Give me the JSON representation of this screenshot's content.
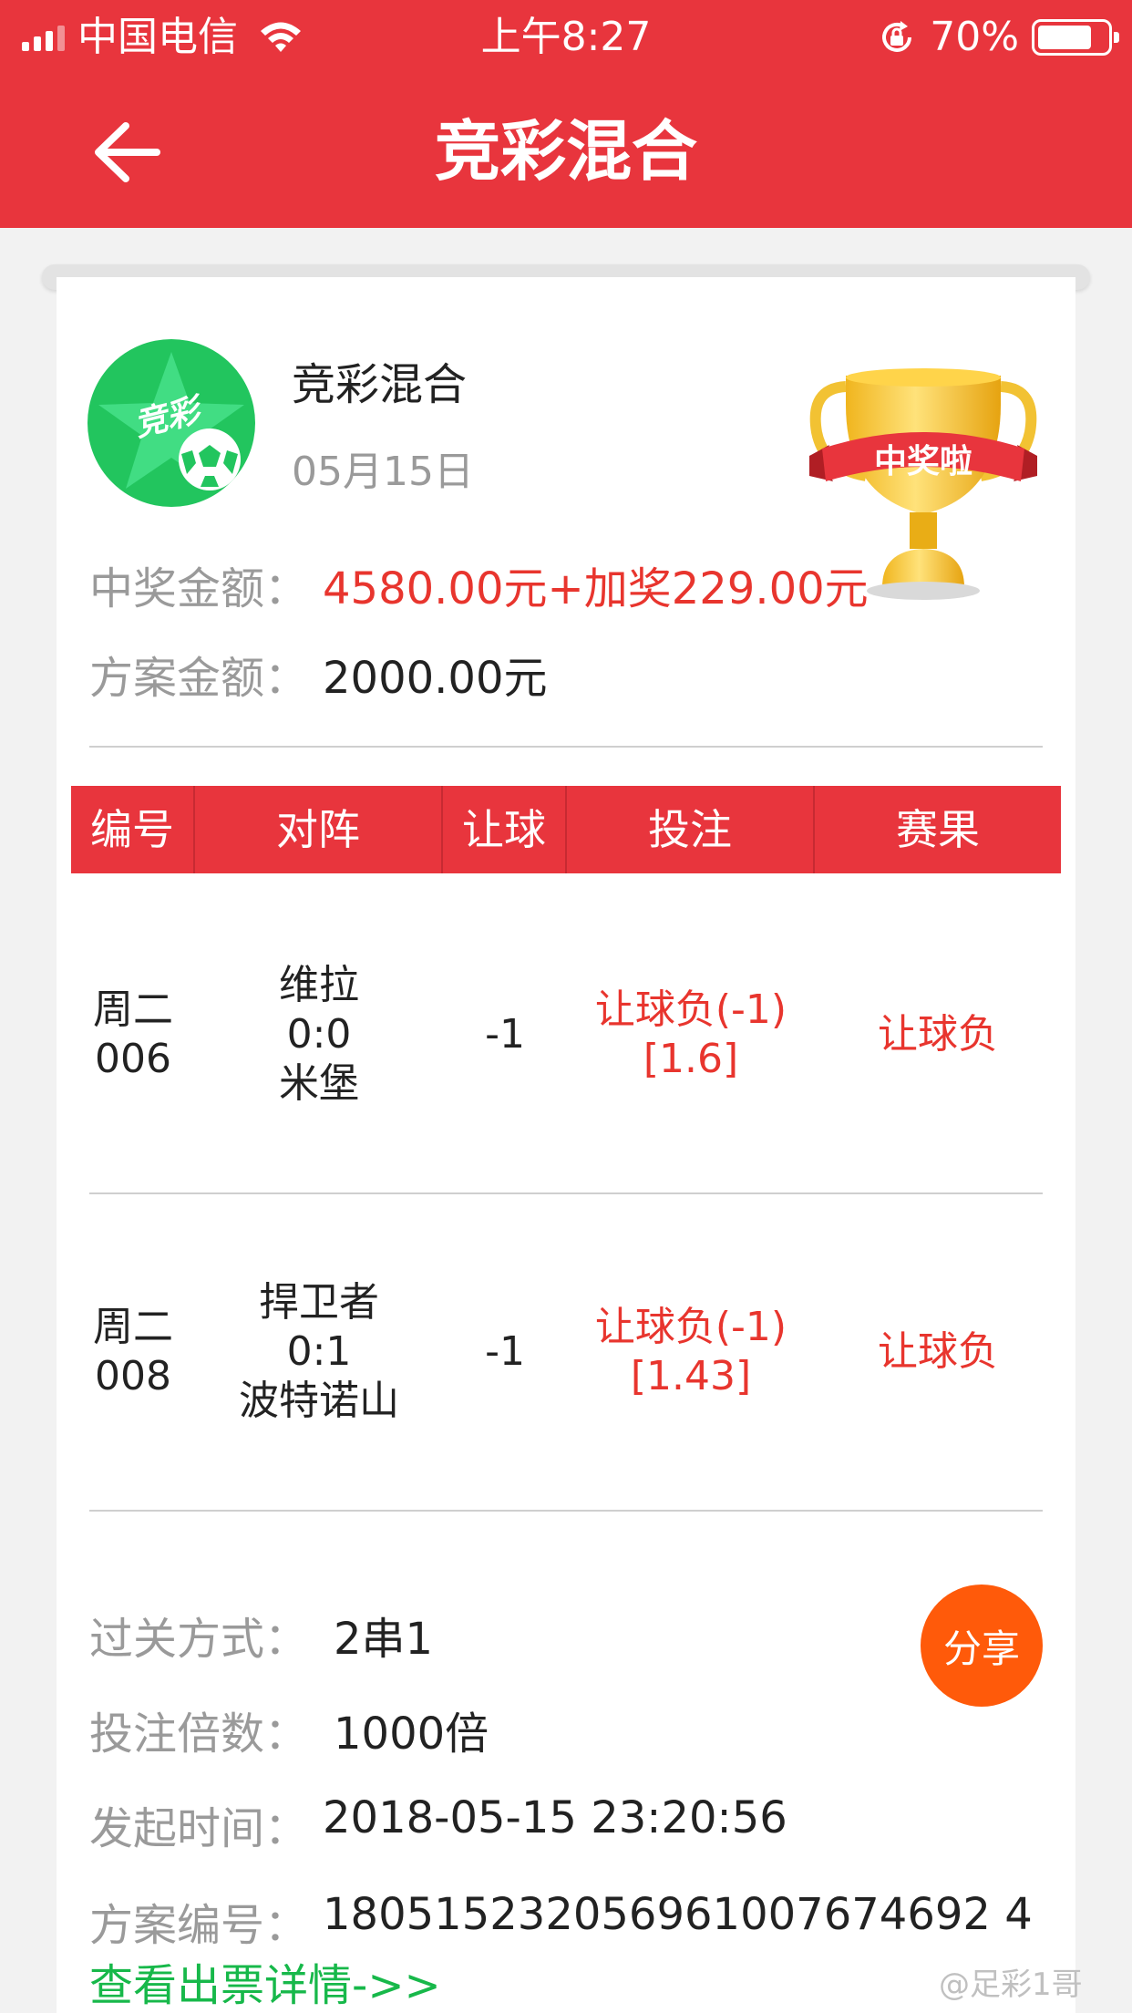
{
  "status_bar": {
    "carrier": "中国电信",
    "time": "上午8:27",
    "battery": "70%"
  },
  "nav": {
    "title": "竞彩混合"
  },
  "summary": {
    "lottery_name": "竞彩混合",
    "logo_text": "竞彩",
    "date": "05月15日",
    "badge_text": "中奖啦",
    "prize_label": "中奖金额：",
    "prize_value": "4580.00元+加奖229.00元",
    "plan_label": "方案金额：",
    "plan_value": "2000.00元"
  },
  "table": {
    "headers": [
      "编号",
      "对阵",
      "让球",
      "投注",
      "赛果"
    ],
    "rows": [
      {
        "day": "周二",
        "num": "006",
        "home": "维拉",
        "score": "0:0",
        "away": "米堡",
        "handicap": "-1",
        "bet": "让球负(-1)[1.6]",
        "result": "让球负"
      },
      {
        "day": "周二",
        "num": "008",
        "home": "捍卫者",
        "score": "0:1",
        "away": "波特诺山",
        "handicap": "-1",
        "bet": "让球负(-1)[1.43]",
        "result": "让球负"
      }
    ]
  },
  "details": {
    "pass_label": "过关方式：",
    "pass_value": "2串1",
    "multiple_label": "投注倍数：",
    "multiple_value": "1000倍",
    "time_label": "发起时间：",
    "time_value": "2018-05-15 23:20:56",
    "id_label": "方案编号：",
    "id_value": "180515232056961007674692 4",
    "share_label": "分享",
    "ticket_link": "查看出票详情->>"
  },
  "watermark": "@足彩1哥",
  "colors": {
    "header_red": "#e8353d",
    "prize_red": "#e8352e",
    "link_green": "#17b84a",
    "share_orange": "#ff5a0a"
  }
}
